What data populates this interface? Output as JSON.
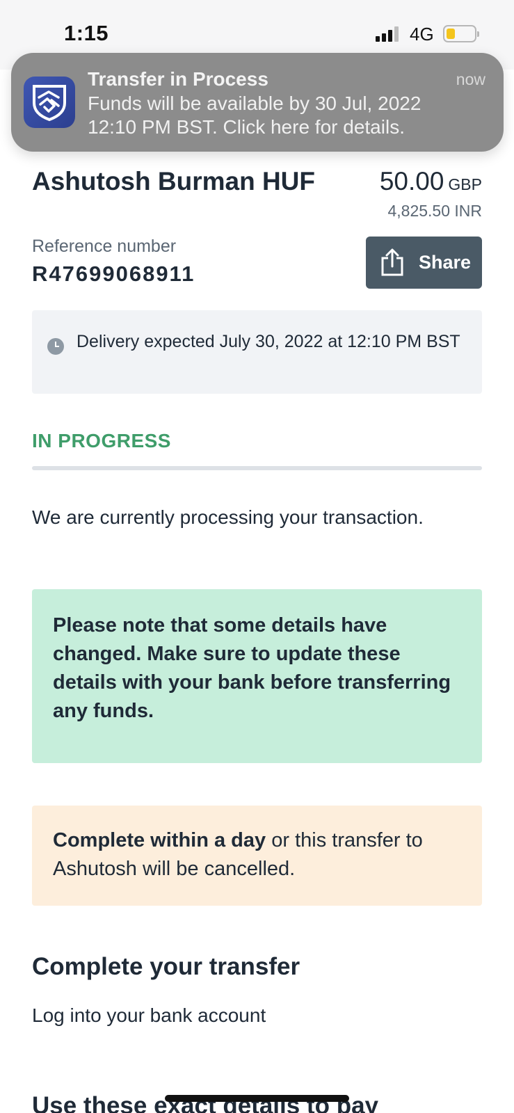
{
  "status_bar": {
    "time": "1:15",
    "network": "4G",
    "battery_level": 0.3,
    "battery_color": "#f4c51c"
  },
  "notification": {
    "app_icon": "handshake-shield-icon",
    "title": "Transfer in Process",
    "time": "now",
    "body": "Funds will be available by 30 Jul, 2022 12:10 PM BST. Click here for details."
  },
  "transfer": {
    "recipient": "Ashutosh Burman HUF",
    "amount": "50.00",
    "currency": "GBP",
    "converted": "4,825.50 INR",
    "reference_label": "Reference number",
    "reference": "R47699068911",
    "share_label": "Share",
    "share_icon": "share-icon"
  },
  "delivery": {
    "icon": "clock-icon",
    "text": "Delivery expected July 30, 2022 at 12:10 PM BST"
  },
  "progress": {
    "status": "IN PROGRESS",
    "fraction": 0,
    "color": "#3f9d6a",
    "message": "We are currently processing your transaction."
  },
  "notice": {
    "text": "Please note that some details have changed. Make sure to update these details with your bank before transferring any funds.",
    "background": "#c6eedb"
  },
  "warning": {
    "bold": "Complete within a day",
    "rest": " or this transfer to Ashutosh will be cancelled.",
    "background": "#fdeedc"
  },
  "complete": {
    "title": "Complete your transfer",
    "subtitle": "Log into your bank account"
  },
  "exact_details": {
    "title": "Use these exact details to pay"
  }
}
